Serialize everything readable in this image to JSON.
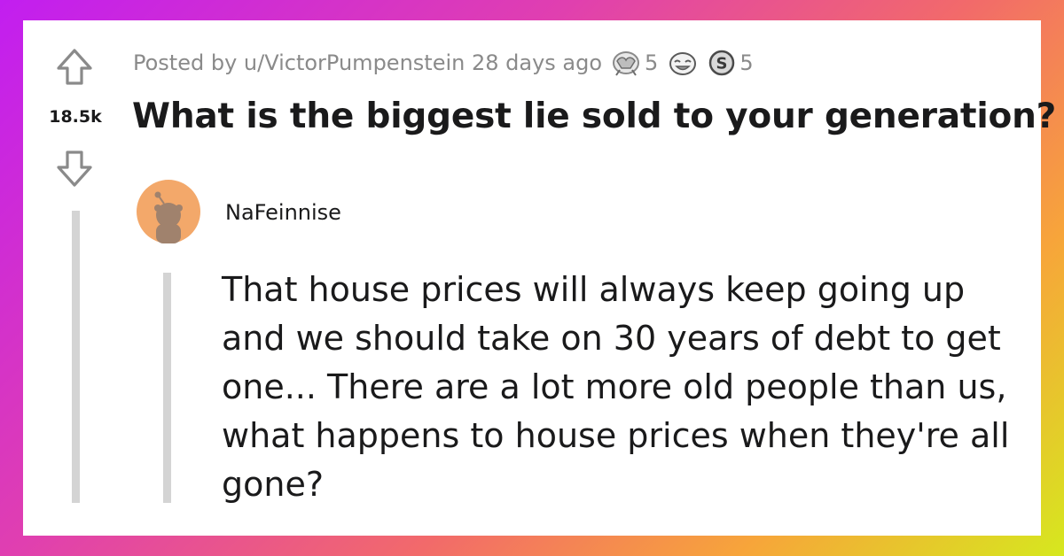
{
  "post": {
    "score": "18.5k",
    "meta_text": "Posted by u/VictorPumpenstein 28 days ago",
    "awards": [
      {
        "icon": "wholesome-award-icon",
        "count": "5"
      },
      {
        "icon": "laugh-award-icon",
        "count": ""
      },
      {
        "icon": "silver-s-award-icon",
        "count": "5"
      }
    ],
    "title": "What is the biggest lie sold to your generation?"
  },
  "comment": {
    "author": "NaFeinnise",
    "avatar_color": "#f3a86a",
    "body": "That house prices will always keep going up and we should take on 30 years of debt to get one... There are a lot more old people than us, what happens to house prices when they're all gone?"
  },
  "colors": {
    "text": "#1a1a1b",
    "meta": "#8a8a8a",
    "thread_line": "#d4d4d4",
    "arrow": "#8a8a8a"
  }
}
